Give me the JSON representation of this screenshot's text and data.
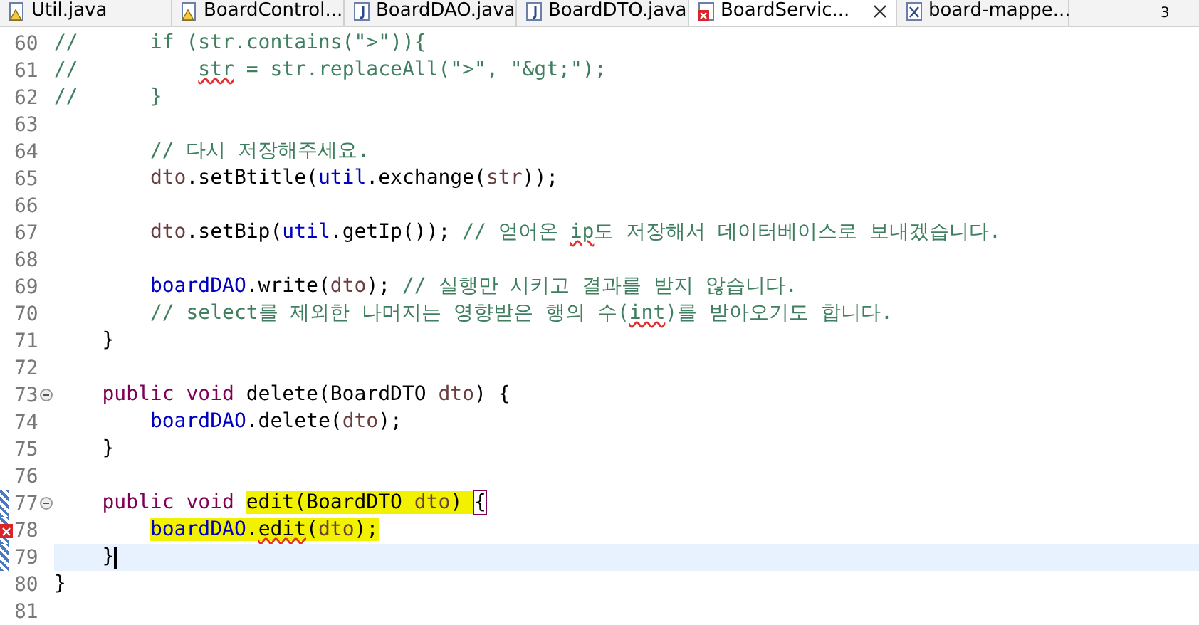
{
  "tabs": [
    {
      "label": "Util.java",
      "kind": "warning",
      "selected": false,
      "closable": false
    },
    {
      "label": "BoardControl...",
      "kind": "warning",
      "selected": false,
      "closable": false
    },
    {
      "label": "BoardDAO.java",
      "kind": "java",
      "selected": false,
      "closable": false
    },
    {
      "label": "BoardDTO.java",
      "kind": "java",
      "selected": false,
      "closable": false
    },
    {
      "label": "BoardServic...",
      "kind": "error",
      "selected": true,
      "closable": true
    },
    {
      "label": "board-mappe...",
      "kind": "xml",
      "selected": false,
      "closable": false
    }
  ],
  "overflow_count": "3",
  "lines": [
    {
      "number": "60",
      "tokens": [
        {
          "text": "//      if (str.contains(\">\")){",
          "kind": "comment"
        }
      ]
    },
    {
      "number": "61",
      "tokens": [
        {
          "text": "//          ",
          "kind": "comment"
        },
        {
          "text": "str",
          "kind": "comment",
          "error": true
        },
        {
          "text": " = str.replaceAll(\">\", \"&gt;\");",
          "kind": "comment"
        }
      ]
    },
    {
      "number": "62",
      "tokens": [
        {
          "text": "//      }",
          "kind": "comment"
        }
      ]
    },
    {
      "number": "63"
    },
    {
      "number": "64",
      "tokens": [
        {
          "text": "        // 다시 저장해주세요.",
          "kind": "comment"
        }
      ]
    },
    {
      "number": "65",
      "tokens": [
        {
          "text": "        dto",
          "kind": "local"
        },
        {
          "text": ".setBtitle(",
          "kind": "plain"
        },
        {
          "text": "util",
          "kind": "field"
        },
        {
          "text": ".exchange(",
          "kind": "plain"
        },
        {
          "text": "str",
          "kind": "local"
        },
        {
          "text": "));",
          "kind": "plain"
        }
      ]
    },
    {
      "number": "66"
    },
    {
      "number": "67",
      "tokens": [
        {
          "text": "        dto",
          "kind": "local"
        },
        {
          "text": ".setBip(",
          "kind": "plain"
        },
        {
          "text": "util",
          "kind": "field"
        },
        {
          "text": ".getIp()); ",
          "kind": "plain"
        },
        {
          "text": "// 얻어온 ",
          "kind": "comment"
        },
        {
          "text": "ip",
          "kind": "comment",
          "error": true
        },
        {
          "text": "도 저장해서 데이터베이스로 보내겠습니다.",
          "kind": "comment"
        }
      ]
    },
    {
      "number": "68"
    },
    {
      "number": "69",
      "tokens": [
        {
          "text": "        boardDAO",
          "kind": "field"
        },
        {
          "text": ".write(",
          "kind": "plain"
        },
        {
          "text": "dto",
          "kind": "local"
        },
        {
          "text": "); ",
          "kind": "plain"
        },
        {
          "text": "// 실행만 시키고 결과를 받지 않습니다.",
          "kind": "comment"
        }
      ]
    },
    {
      "number": "70",
      "tokens": [
        {
          "text": "        // select를 제외한 나머지는 영향받은 행의 수(",
          "kind": "comment"
        },
        {
          "text": "int",
          "kind": "comment",
          "error": true
        },
        {
          "text": ")를 받아오기도 합니다.",
          "kind": "comment"
        }
      ]
    },
    {
      "number": "71",
      "tokens": [
        {
          "text": "    }",
          "kind": "plain"
        }
      ]
    },
    {
      "number": "72"
    },
    {
      "number": "73",
      "fold": true,
      "tokens": [
        {
          "text": "    public void",
          "kind": "keyword"
        },
        {
          "text": " delete(BoardDTO ",
          "kind": "plain"
        },
        {
          "text": "dto",
          "kind": "local"
        },
        {
          "text": ") {",
          "kind": "plain"
        }
      ]
    },
    {
      "number": "74",
      "tokens": [
        {
          "text": "        boardDAO",
          "kind": "field"
        },
        {
          "text": ".delete(",
          "kind": "plain"
        },
        {
          "text": "dto",
          "kind": "local"
        },
        {
          "text": ");",
          "kind": "plain"
        }
      ]
    },
    {
      "number": "75",
      "tokens": [
        {
          "text": "    }",
          "kind": "plain"
        }
      ]
    },
    {
      "number": "76"
    },
    {
      "number": "77",
      "fold": true,
      "changed": true,
      "tokens": [
        {
          "text": "    public void ",
          "kind": "keyword"
        },
        {
          "text": "edit(BoardDTO ",
          "kind": "plain",
          "highlight": true
        },
        {
          "text": "dto",
          "kind": "local",
          "highlight": true
        },
        {
          "text": ") ",
          "kind": "plain",
          "highlight": true
        },
        {
          "text": "{",
          "kind": "plain",
          "bracket": true
        }
      ]
    },
    {
      "number": "78",
      "changed": true,
      "error_marker": true,
      "tokens": [
        {
          "text": "        boardDAO",
          "kind": "field",
          "highlight": true
        },
        {
          "text": ".",
          "kind": "plain",
          "highlight": true
        },
        {
          "text": "edit",
          "kind": "plain",
          "highlight": true,
          "error": true
        },
        {
          "text": "(",
          "kind": "plain",
          "highlight": true
        },
        {
          "text": "dto",
          "kind": "local",
          "highlight": true
        },
        {
          "text": ");",
          "kind": "plain",
          "highlight": true
        }
      ]
    },
    {
      "number": "79",
      "changed": true,
      "current": true,
      "tokens": [
        {
          "text": "    }",
          "kind": "plain"
        }
      ]
    },
    {
      "number": "80",
      "tokens": [
        {
          "text": "}",
          "kind": "plain"
        }
      ]
    },
    {
      "number": "81"
    }
  ]
}
